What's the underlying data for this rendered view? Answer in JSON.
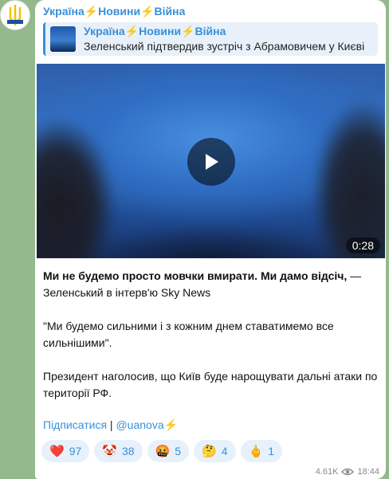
{
  "channel": {
    "name": "Україна⚡Новини⚡Війна",
    "avatar_icon": "ukraine-trident-icon"
  },
  "reply": {
    "title": "Україна⚡Новини⚡Війна",
    "text": "Зеленський підтвердив зустріч з Абрамовичем у Києві"
  },
  "video": {
    "duration": "0:28",
    "play_icon": "play-icon"
  },
  "message": {
    "line1_bold": "Ми не будемо просто мовчки вмирати. Ми дамо відсіч,",
    "line1_rest": " — Зеленський в інтерв'ю Sky News",
    "quote": "\"Ми будемо сильними і з кожним днем ставатимемо все сильнішими\".",
    "body": "Президент наголосив, що Київ буде нарощувати дальні атаки по території РФ."
  },
  "links": {
    "subscribe": "Підписатися",
    "separator": " | ",
    "handle": "@uanova⚡"
  },
  "reactions": [
    {
      "emoji": "❤️",
      "count": "97"
    },
    {
      "emoji": "🤡",
      "count": "38"
    },
    {
      "emoji": "🤬",
      "count": "5"
    },
    {
      "emoji": "🤔",
      "count": "4"
    },
    {
      "emoji": "🖕",
      "count": "1"
    }
  ],
  "meta": {
    "views": "4.61K",
    "time": "18:44"
  },
  "colors": {
    "accent": "#3a8fd6",
    "reaction_bg": "#e6f1fb",
    "chat_bg": "#94b98c"
  }
}
